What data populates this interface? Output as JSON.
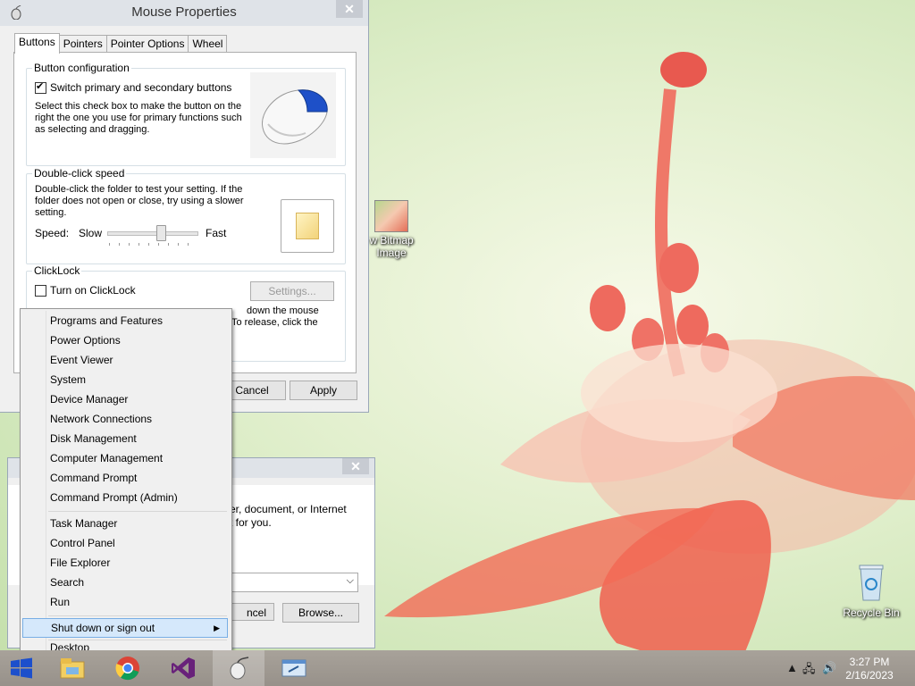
{
  "mouse_properties": {
    "title": "Mouse Properties",
    "tabs": [
      "Buttons",
      "Pointers",
      "Pointer Options",
      "Wheel"
    ],
    "button_configuration": {
      "label": "Button configuration",
      "switch_checkbox_label": "Switch primary and secondary buttons",
      "switch_checked": true,
      "description": "Select this check box to make the button on the right the one you use for primary functions such as selecting and dragging."
    },
    "double_click": {
      "label": "Double-click speed",
      "description": "Double-click the folder to test your setting. If the folder does not open or close, try using a slower setting.",
      "speed_label": "Speed:",
      "slow_label": "Slow",
      "fast_label": "Fast",
      "speed_value": 0.6
    },
    "clicklock": {
      "label": "ClickLock",
      "checkbox_label": "Turn on ClickLock",
      "checked": false,
      "settings_button": "Settings...",
      "desc_line1_visible": "down the mouse",
      "desc_line2_visible": "To release, click the"
    },
    "cancel_button": "Cancel",
    "apply_button": "Apply"
  },
  "run_dialog": {
    "text_line1": "er, document, or Internet",
    "text_line2": "t for you.",
    "cancel_partial": "ncel",
    "browse_button": "Browse..."
  },
  "context_menu": {
    "group1": [
      "Programs and Features",
      "Power Options",
      "Event Viewer",
      "System",
      "Device Manager",
      "Network Connections",
      "Disk Management",
      "Computer Management",
      "Command Prompt",
      "Command Prompt (Admin)"
    ],
    "group2": [
      "Task Manager",
      "Control Panel",
      "File Explorer",
      "Search",
      "Run"
    ],
    "shutdown": "Shut down or sign out",
    "desktop": "Desktop"
  },
  "desktop_icons": {
    "bitmap_line1": "w Bitmap",
    "bitmap_line2": "Image",
    "recycle_bin": "Recycle Bin"
  },
  "taskbar": {
    "apps": [
      "file-explorer-icon",
      "chrome-icon",
      "visual-studio-icon",
      "mouse-icon",
      "run-icon"
    ],
    "time": "3:27 PM",
    "date": "2/16/2023"
  }
}
